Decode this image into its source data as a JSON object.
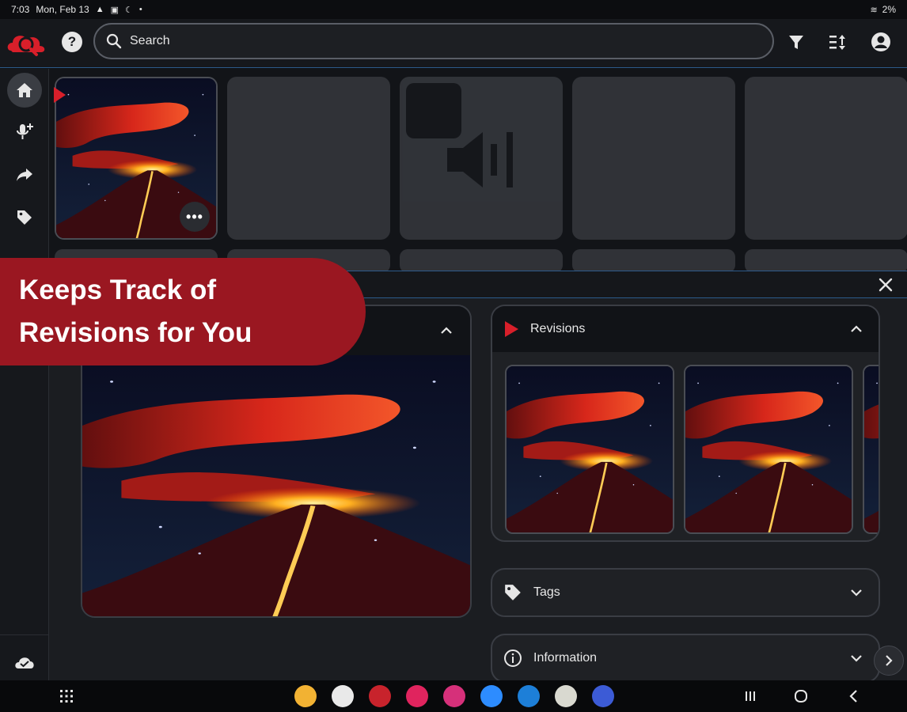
{
  "status_bar": {
    "time": "7:03",
    "date": "Mon, Feb 13",
    "battery": "2%"
  },
  "header": {
    "search_placeholder": "Search"
  },
  "promo": {
    "text": "Keeps Track of Revisions for You"
  },
  "detail": {
    "sections": [
      {
        "title": "Revisions",
        "icon": "play-triangle-icon",
        "expanded": true
      },
      {
        "title": "Tags",
        "icon": "tag-icon",
        "expanded": false
      },
      {
        "title": "Information",
        "icon": "info-icon",
        "expanded": false
      }
    ]
  },
  "colors": {
    "accent": "#9a1721",
    "brand_red": "#d81f2a",
    "divider": "#2c5b8b",
    "background": "#16181c"
  },
  "taskbar": {
    "apps": [
      {
        "name": "files",
        "color": "#f2b233"
      },
      {
        "name": "slack",
        "color": "#e9e9e9"
      },
      {
        "name": "cloud-app",
        "color": "#c8232c"
      },
      {
        "name": "camera-app",
        "color": "#e0245e"
      },
      {
        "name": "flower-app",
        "color": "#d6307a"
      },
      {
        "name": "zoom",
        "color": "#2d8cff"
      },
      {
        "name": "s-app",
        "color": "#1d7fd8"
      },
      {
        "name": "plant-app",
        "color": "#d9d9d0"
      },
      {
        "name": "settings",
        "color": "#3c5bd6"
      }
    ]
  }
}
